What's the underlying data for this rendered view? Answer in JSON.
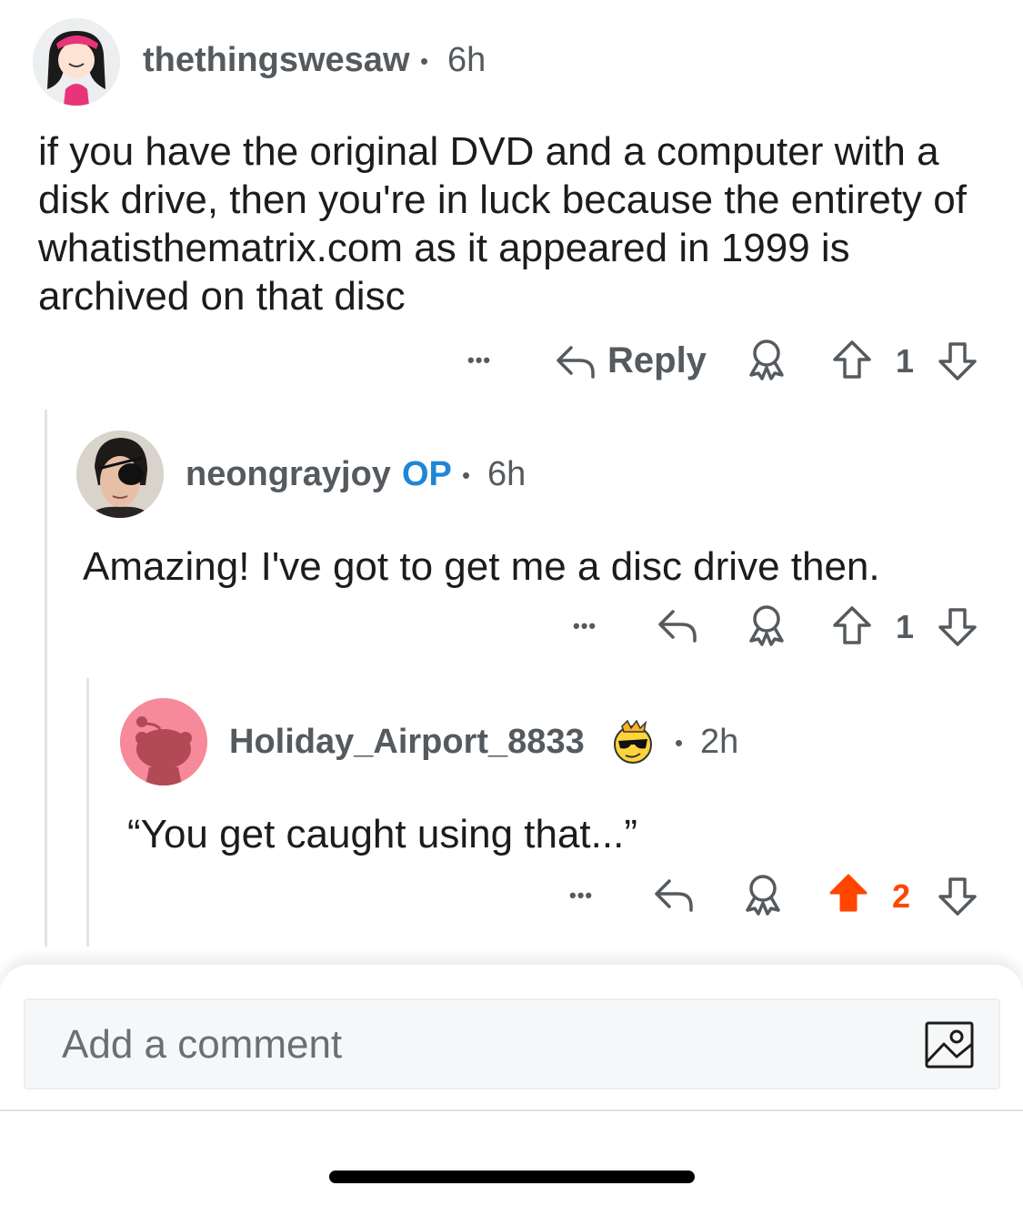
{
  "comments": [
    {
      "username": "thethingswesaw",
      "separator": "•",
      "age": "6h",
      "body": "if you have the original DVD and a computer with a disk drive, then you're in luck because the entirety of whatisthematrix.com as it appeared in 1999 is archived on that disc",
      "actions": {
        "more": "•••",
        "reply": "Reply",
        "score": "1"
      }
    },
    {
      "username": "neongrayjoy",
      "op_badge": "OP",
      "separator": "•",
      "age": "6h",
      "body": "Amazing! I've got to get me a disc drive then.",
      "actions": {
        "more": "•••",
        "score": "1"
      }
    },
    {
      "username": "Holiday_Airport_8833",
      "separator": "•",
      "age": "2h",
      "body": "“You get caught using that...”",
      "actions": {
        "more": "•••",
        "score": "2",
        "upvoted": true
      }
    }
  ],
  "composer": {
    "placeholder": "Add a comment"
  },
  "colors": {
    "upvote": "#ff4500",
    "op": "#1f86d6",
    "meta": "#555a5e"
  }
}
